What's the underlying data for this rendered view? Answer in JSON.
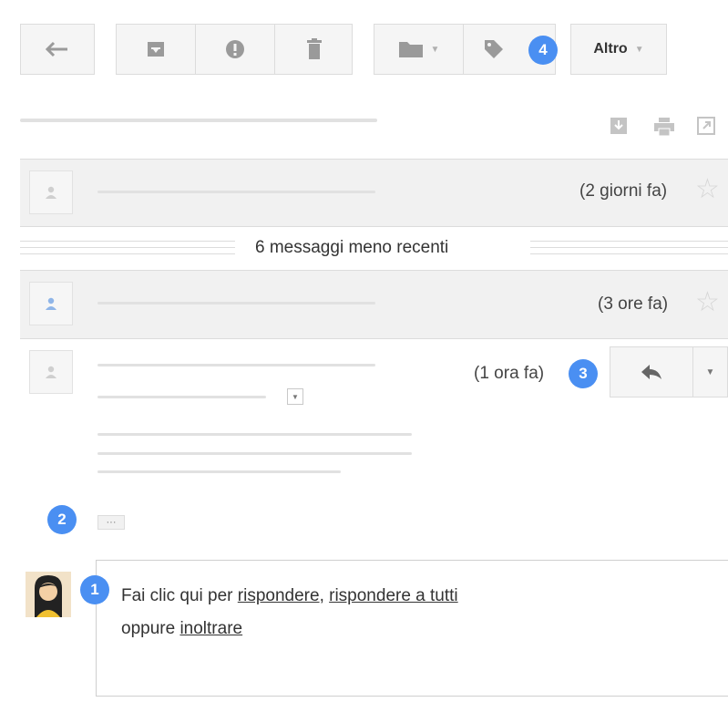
{
  "toolbar": {
    "back_icon": "back-arrow-icon",
    "archive_icon": "archive-icon",
    "spam_icon": "report-spam-icon",
    "delete_icon": "trash-icon",
    "folder_icon": "folder-icon",
    "label_icon": "label-tag-icon",
    "more_label": "Altro"
  },
  "header_icons": [
    "download-icon",
    "print-icon",
    "new-window-icon"
  ],
  "thread": {
    "message1": {
      "time": "(2 giorni fa)"
    },
    "collapsed_label": "6 messaggi meno recenti",
    "message2": {
      "time": "(3 ore fa)"
    },
    "message3": {
      "time": "(1 ora fa)"
    }
  },
  "trimmed_content_label": "···",
  "reply_box": {
    "prefix": "Fai clic qui per ",
    "reply": "rispondere",
    "comma": ", ",
    "reply_all": "rispondere a tutti",
    "or": "oppure ",
    "forward": "inoltrare"
  },
  "badges": {
    "b1": "1",
    "b2": "2",
    "b3": "3",
    "b4": "4"
  },
  "colors": {
    "badge": "#4a8ff2",
    "panel_bg": "#f1f1f1",
    "border": "#dcdcdc"
  }
}
